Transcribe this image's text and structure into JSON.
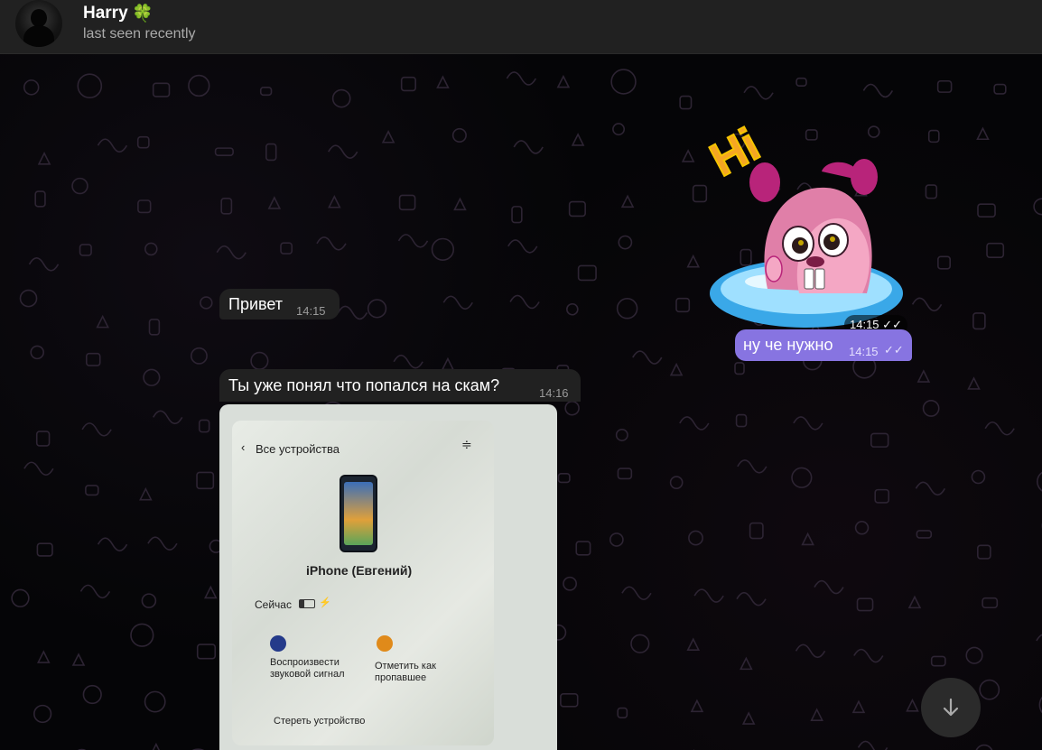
{
  "header": {
    "name": "Harry",
    "name_emoji": "🍀",
    "status": "last seen recently"
  },
  "messages": [
    {
      "type": "sticker",
      "direction": "out",
      "text": "Hi",
      "time": "14:15",
      "read": true
    },
    {
      "type": "text",
      "direction": "in",
      "text": "Привет",
      "time": "14:15"
    },
    {
      "type": "text",
      "direction": "out",
      "text": "ну че нужно",
      "time": "14:15",
      "read": true
    },
    {
      "type": "text",
      "direction": "in",
      "text": "Ты уже понял что попался на скам?",
      "time": "14:16"
    }
  ],
  "photo": {
    "back_label": "Все устройства",
    "device_name": "iPhone (Евгений)",
    "now_label": "Сейчас",
    "action_sound": "Воспроизвести звуковой сигнал",
    "action_lost": "Отметить как пропавшее",
    "erase": "Стереть устройство"
  },
  "colors": {
    "accent": "#8774e1",
    "incoming_bubble": "#212121",
    "header_bg": "#212121"
  },
  "icons": {
    "read_receipt": "double-check-icon",
    "scroll_down": "arrow-down-icon"
  }
}
